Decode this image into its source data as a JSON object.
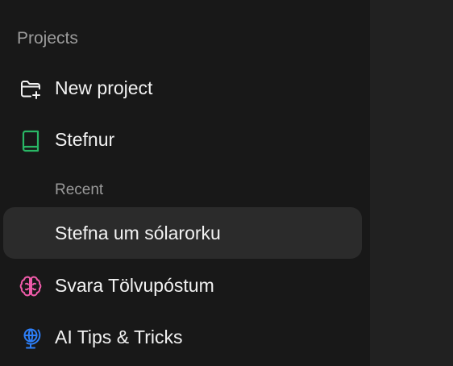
{
  "sidebar": {
    "heading": "Projects",
    "new_project": {
      "label": "New project",
      "icon": "folder-plus-icon"
    },
    "project": {
      "label": "Stefnur",
      "icon": "book-icon",
      "icon_color": "#29b765"
    },
    "recent_heading": "Recent",
    "recent_items": [
      {
        "label": "Stefna um sólarorku"
      }
    ],
    "other_projects": [
      {
        "label": "Svara Tölvupóstum",
        "icon": "brain-icon",
        "icon_color": "#ef5ba9"
      },
      {
        "label": "AI Tips & Tricks",
        "icon": "globe-stand-icon",
        "icon_color": "#2d7ff9"
      }
    ]
  },
  "colors": {
    "sidebar_bg": "#181818",
    "main_bg": "#212121",
    "active_item_bg": "#2b2b2b",
    "text_primary": "#f2f2f2",
    "text_muted": "#9b9b9b"
  }
}
